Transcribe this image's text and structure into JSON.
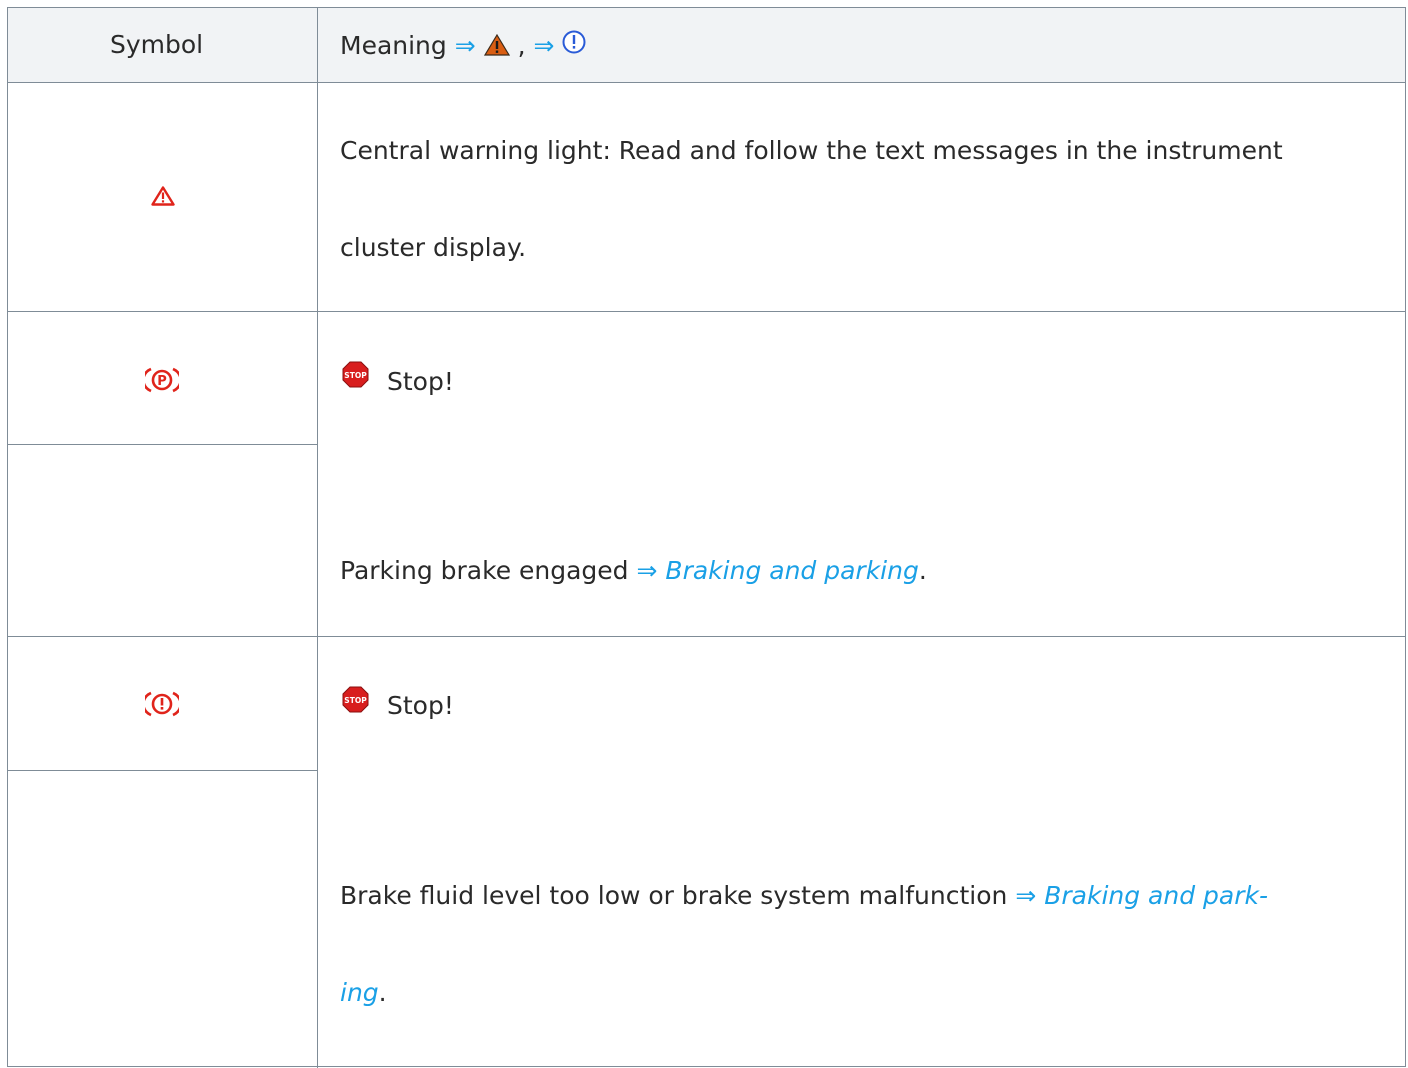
{
  "table": {
    "header": {
      "symbol": "Symbol",
      "meaning": "Meaning",
      "arrow": "⇒",
      "comma": ","
    },
    "rows": [
      {
        "symbol_icon": "central-warning-triangle-icon",
        "line1": "Central warning light: Read and follow the text messages in the instrument",
        "line2": "cluster display."
      },
      {
        "symbol_icon": "parking-brake-icon",
        "stop_icon": "stop-sign-icon",
        "stop_label": "Stop!",
        "text": "Parking brake engaged",
        "arrow": "⇒",
        "link": "Braking and parking",
        "end": "."
      },
      {
        "symbol_icon": "brake-system-warning-icon",
        "stop_icon": "stop-sign-icon",
        "stop_label": "Stop!",
        "text": "Brake fluid level too low or brake system malfunction",
        "arrow": "⇒",
        "link_part1": "Braking and park-",
        "link_part2": "ing",
        "end": "."
      }
    ]
  },
  "colors": {
    "border": "#7f8c97",
    "header_bg": "#f1f3f5",
    "link": "#1aa0e6",
    "warning_red": "#e0241b",
    "warning_orange": "#d95d12",
    "info_blue": "#2a5bd7"
  }
}
